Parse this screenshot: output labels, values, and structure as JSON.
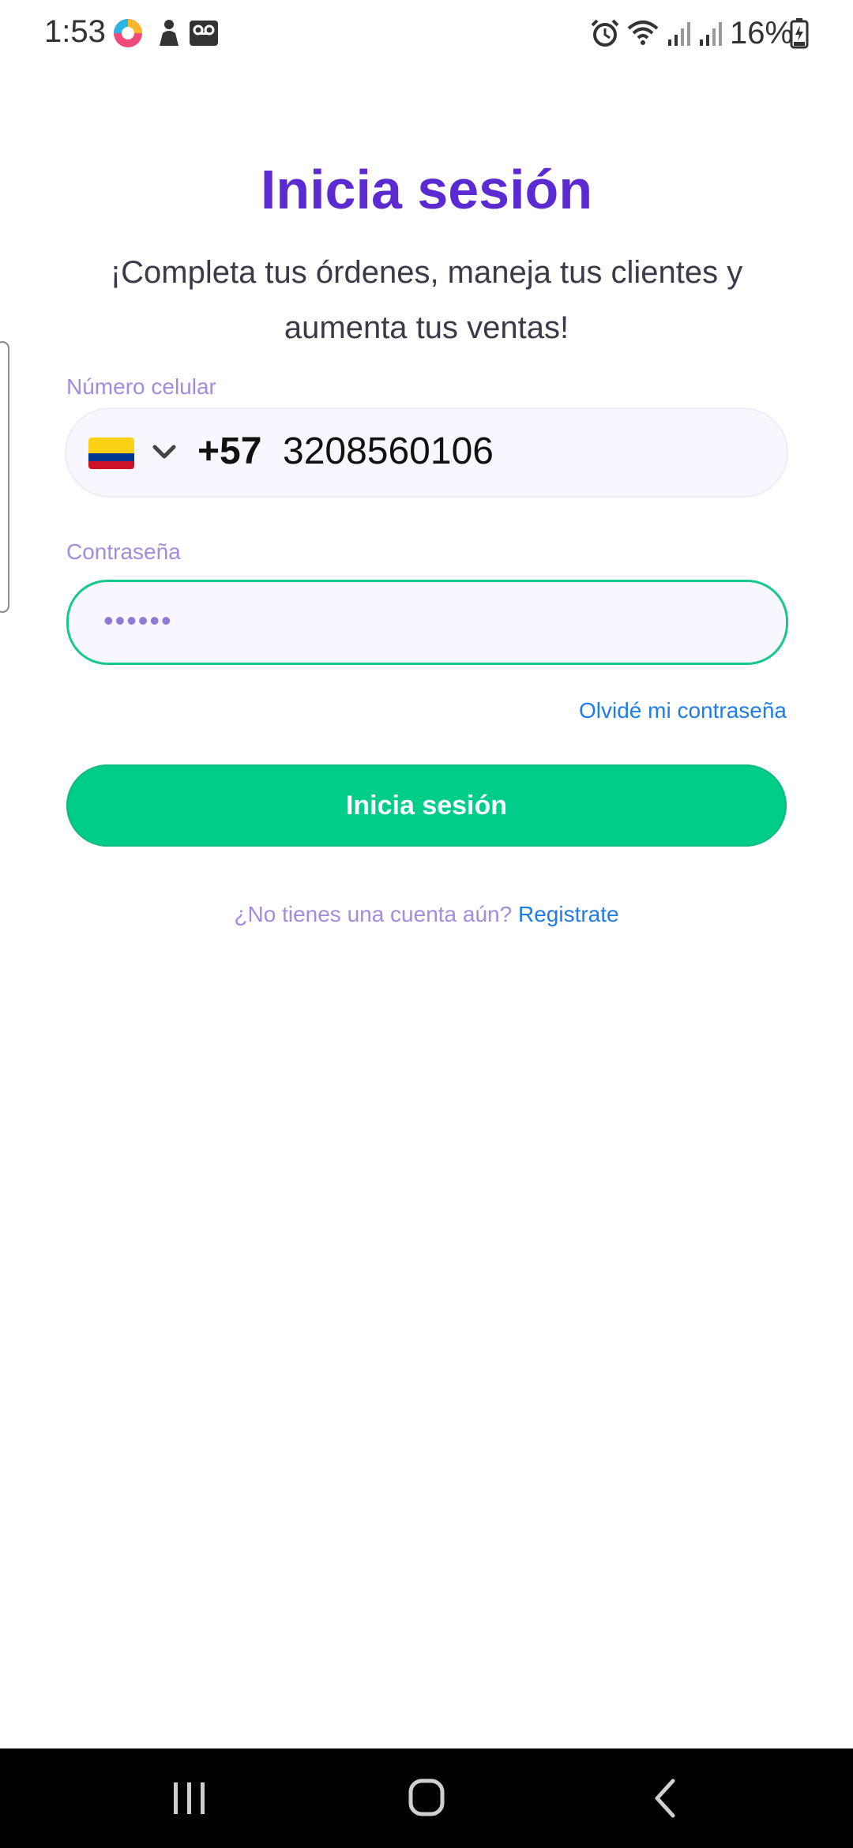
{
  "status_bar": {
    "time": "1:53",
    "battery": "16%"
  },
  "login": {
    "title": "Inicia sesión",
    "subtitle": "¡Completa tus órdenes, maneja tus clientes y aumenta tus ventas!",
    "phone": {
      "label": "Número celular",
      "country_flag": "colombia-flag",
      "country_code": "+57",
      "number": "3208560106"
    },
    "password": {
      "label": "Contraseña",
      "value": "••••••"
    },
    "forgot_link": "Olvidé mi contraseña",
    "submit_label": "Inicia sesión",
    "register_prompt": "¿No tienes una cuenta aún?",
    "register_link": "Registrate"
  },
  "colors": {
    "title": "#5b2bd1",
    "accent_green": "#00cd8a",
    "link_blue": "#1e7de6",
    "label_purple": "#a48be0"
  },
  "nav": {
    "recents_icon": "recents-icon",
    "home_icon": "home-icon",
    "back_icon": "back-icon"
  }
}
